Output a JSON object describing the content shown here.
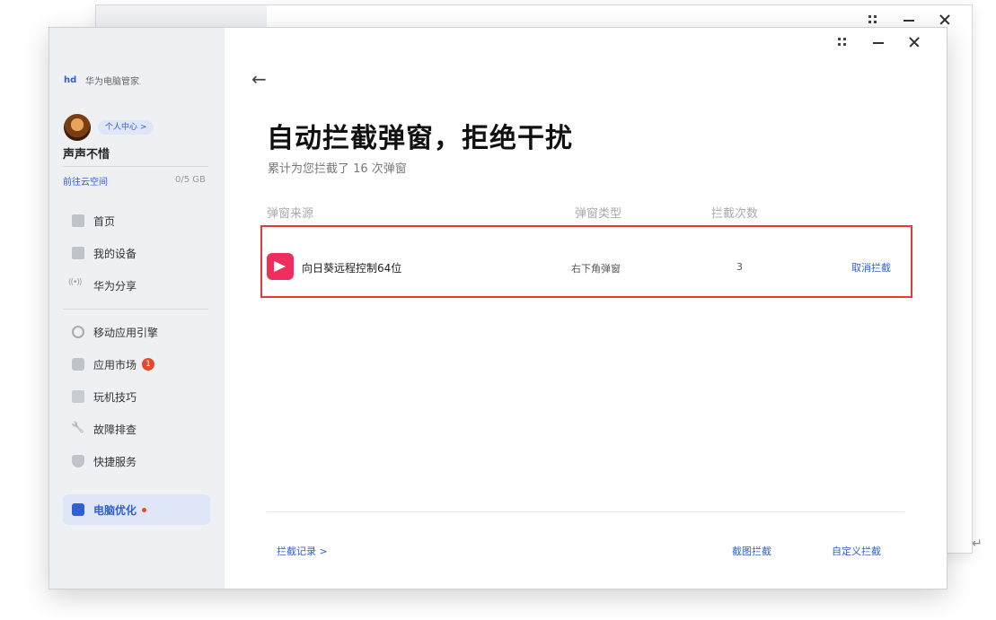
{
  "brand": {
    "name": "华为电脑管家",
    "logo_text": "hd"
  },
  "user": {
    "center_label": "个人中心 >",
    "name": "声声不惜"
  },
  "cloud": {
    "link_label": "前往云空间",
    "quota": "0/5 GB"
  },
  "sidebar": {
    "items": [
      {
        "label": "首页",
        "icon": "home-icon"
      },
      {
        "label": "我的设备",
        "icon": "device-icon"
      },
      {
        "label": "华为分享",
        "icon": "share-icon"
      },
      {
        "label": "移动应用引擎",
        "icon": "engine-icon"
      },
      {
        "label": "应用市场",
        "icon": "market-icon",
        "badge": "1"
      },
      {
        "label": "玩机技巧",
        "icon": "tips-icon"
      },
      {
        "label": "故障排查",
        "icon": "wrench-icon"
      },
      {
        "label": "快捷服务",
        "icon": "shield-icon"
      }
    ],
    "active_item": {
      "label": "电脑优化",
      "icon": "optimize-icon"
    }
  },
  "main": {
    "title": "自动拦截弹窗，拒绝干扰",
    "subtitle": "累计为您拦截了 16 次弹窗",
    "table": {
      "headers": [
        "弹窗来源",
        "弹窗类型",
        "拦截次数"
      ],
      "rows": [
        {
          "app": "向日葵远程控制64位",
          "type": "右下角弹窗",
          "count": "3",
          "action": "取消拦截"
        }
      ]
    },
    "footer": {
      "records_label": "拦截记录 >",
      "screenshot_block_label": "截图拦截",
      "custom_block_label": "自定义拦截"
    }
  },
  "colors": {
    "accent": "#2f5fd0",
    "highlight_border": "#e53935",
    "app_icon": "#ef2e5e"
  },
  "misc": {
    "return_mark": "↵"
  }
}
